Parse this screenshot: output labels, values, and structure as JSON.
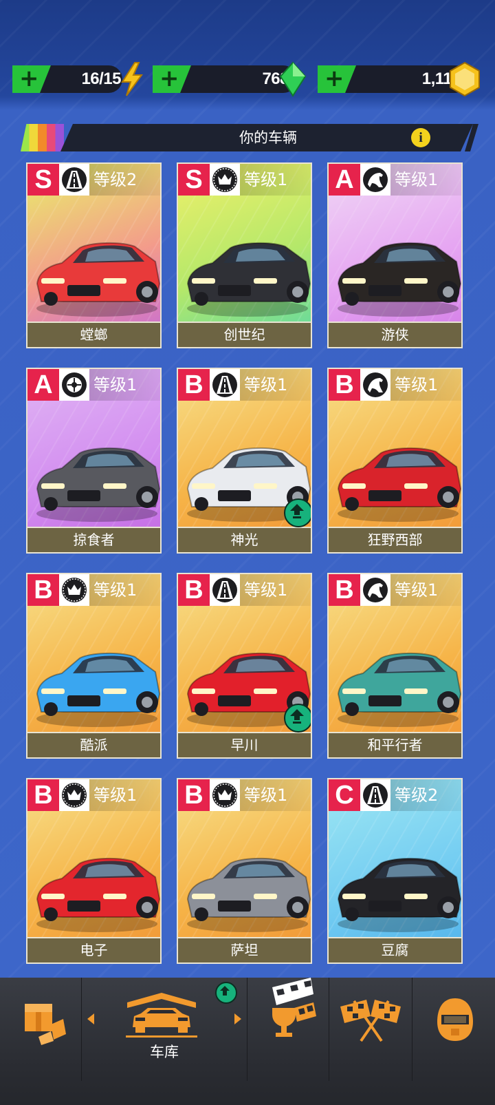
{
  "currencies": [
    {
      "id": "energy",
      "value": "16/15",
      "icon": "lightning-icon"
    },
    {
      "id": "gems",
      "value": "768",
      "icon": "green-gem-icon"
    },
    {
      "id": "coins",
      "value": "1,113",
      "icon": "gold-coin-icon"
    }
  ],
  "section": {
    "title": "你的车辆",
    "info_icon": "i"
  },
  "cars": [
    {
      "name": "螳螂",
      "rank": "S",
      "level": "等级2",
      "type": "road-icon",
      "bg": [
        "#e9f06a",
        "#f39b8b",
        "#c56ad9"
      ],
      "color": "#e83a3a",
      "upgrade": false
    },
    {
      "name": "创世纪",
      "rank": "S",
      "level": "等级1",
      "type": "crown-icon",
      "bg": [
        "#f0f06a",
        "#b4e86a",
        "#59d7a6"
      ],
      "color": "#2f3036",
      "upgrade": false
    },
    {
      "name": "游侠",
      "rank": "A",
      "level": "等级1",
      "type": "horse-icon",
      "bg": [
        "#f0d8f5",
        "#e6a6f2",
        "#d27ae6"
      ],
      "color": "#2a2624",
      "upgrade": false
    },
    {
      "name": "掠食者",
      "rank": "A",
      "level": "等级1",
      "type": "tire-icon",
      "bg": [
        "#e0b5f4",
        "#d38ef0",
        "#c267e2"
      ],
      "color": "#58595f",
      "upgrade": false
    },
    {
      "name": "神光",
      "rank": "B",
      "level": "等级1",
      "type": "road-icon",
      "bg": [
        "#f7e08a",
        "#f6b448",
        "#f09435"
      ],
      "color": "#e9ebef",
      "upgrade": true
    },
    {
      "name": "狂野西部",
      "rank": "B",
      "level": "等级1",
      "type": "horse-icon",
      "bg": [
        "#f7e08a",
        "#f6b448",
        "#f09435"
      ],
      "color": "#d9232b",
      "upgrade": false
    },
    {
      "name": "酷派",
      "rank": "B",
      "level": "等级1",
      "type": "crown-icon",
      "bg": [
        "#f7e08a",
        "#f6b448",
        "#f09435"
      ],
      "color": "#3aa6f0",
      "upgrade": false
    },
    {
      "name": "早川",
      "rank": "B",
      "level": "等级1",
      "type": "road-icon",
      "bg": [
        "#f7e08a",
        "#f6b448",
        "#f09435"
      ],
      "color": "#e2202b",
      "upgrade": true
    },
    {
      "name": "和平行者",
      "rank": "B",
      "level": "等级1",
      "type": "horse-icon",
      "bg": [
        "#f7e08a",
        "#f6b448",
        "#f09435"
      ],
      "color": "#3fa69c",
      "upgrade": false
    },
    {
      "name": "电子",
      "rank": "B",
      "level": "等级1",
      "type": "crown-icon",
      "bg": [
        "#f7e08a",
        "#f6b448",
        "#f09435"
      ],
      "color": "#e3262d",
      "upgrade": false
    },
    {
      "name": "萨坦",
      "rank": "B",
      "level": "等级1",
      "type": "crown-icon",
      "bg": [
        "#f7e08a",
        "#f6b448",
        "#f09435"
      ],
      "color": "#8c9099",
      "upgrade": false
    },
    {
      "name": "豆腐",
      "rank": "C",
      "level": "等级2",
      "type": "road-icon",
      "bg": [
        "#9ee7f3",
        "#74cdf2",
        "#4fb1ea"
      ],
      "color": "#242428",
      "upgrade": false
    }
  ],
  "nav": {
    "items": [
      {
        "id": "shop",
        "icon": "shop-box-icon"
      },
      {
        "id": "garage",
        "icon": "garage-car-icon",
        "label": "车库",
        "active": true,
        "upgrade": true
      },
      {
        "id": "events",
        "icon": "trophy-flag-icon"
      },
      {
        "id": "race",
        "icon": "checkered-flags-icon"
      },
      {
        "id": "profile",
        "icon": "helmet-icon"
      }
    ]
  },
  "colors": {
    "rank_bg": "#e6234c",
    "name_bar": "#6d6443",
    "accent_orange": "#f29a2e",
    "plus_green": "#27c33a"
  }
}
